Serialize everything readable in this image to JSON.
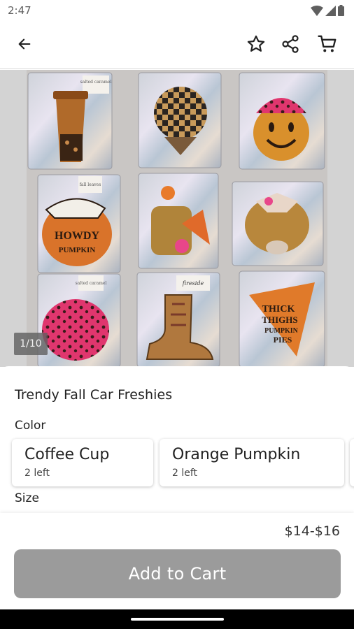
{
  "status_bar": {
    "time": "2:47"
  },
  "toolbar": {
    "back_icon": "arrow-left-icon",
    "favorite_icon": "star-outline-icon",
    "share_icon": "share-icon",
    "cart_icon": "cart-icon"
  },
  "gallery": {
    "counter": "1/10",
    "bag_tags": [
      "salted caramel",
      "",
      "",
      "fall leaves",
      "",
      "",
      "salted caramel",
      "fireside",
      ""
    ],
    "freshie_text": [
      "HOWDY",
      "PUMPKIN",
      "THICK",
      "THIGHS",
      "PUMPKIN",
      "PIES"
    ]
  },
  "product": {
    "title": "Trendy Fall Car Freshies",
    "color_label": "Color",
    "options": [
      {
        "name": "Coffee Cup",
        "stock": "2 left"
      },
      {
        "name": "Orange Pumpkin",
        "stock": "2 left"
      }
    ],
    "size_label": "Size"
  },
  "purchase": {
    "price": "$14-$16",
    "add_to_cart": "Add to Cart"
  },
  "colors": {
    "button_disabled": "#9b9b9b",
    "toolbar_bg": "#ffffff",
    "nav_bar": "#000000"
  }
}
